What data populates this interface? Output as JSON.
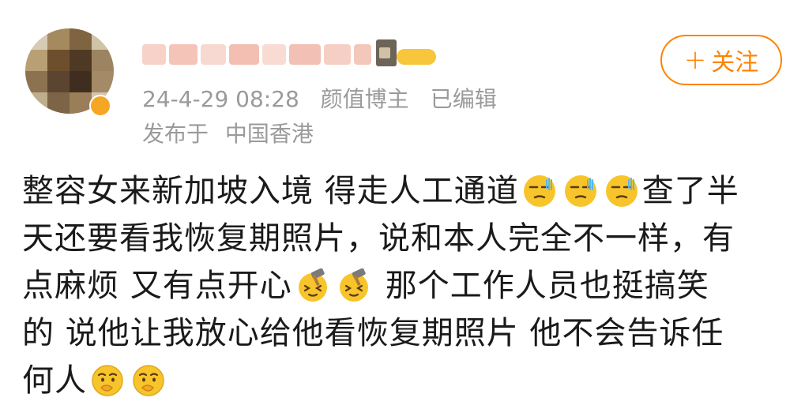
{
  "post": {
    "author": {
      "avatar_icon": "avatar-blurred",
      "name_icon": "username-blurred"
    },
    "meta": {
      "date": "24-4-29 08:28",
      "source": "颜值博主",
      "edited": "已编辑"
    },
    "location": {
      "prefix": "发布于",
      "place": "中国香港"
    },
    "follow_button": {
      "label": "关注",
      "icon": "plus-icon"
    },
    "body": {
      "line1_a": "整容女来新加坡入境 得走人工通道",
      "line1_b": "查了半",
      "line2": "天还要看我恢复期照片，说和本人完全不一样，有",
      "line3_a": "点麻烦 又有点开心",
      "line3_b": "那个工作人员也挺搞笑",
      "line4": "的 说他让我放心给他看恢复期照片 他不会告诉任",
      "line5": "何人"
    },
    "emoji_icons": {
      "sweat": "sweat-smirk-emoji-icon",
      "hammer": "hammer-grin-emoji-icon",
      "think": "thinking-emoji-icon"
    },
    "colors": {
      "accent": "#ff8200",
      "meta_text": "#9a9a9a",
      "body_text": "#1a1a1a",
      "emoji_yellow": "#f7c52b"
    }
  }
}
